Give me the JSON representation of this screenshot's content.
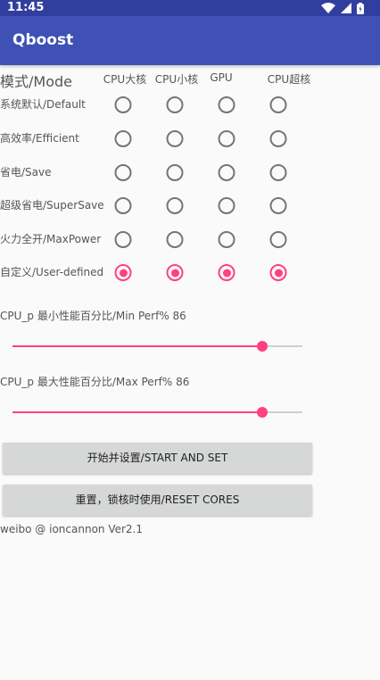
{
  "status_bar": {
    "time": "11:45"
  },
  "app": {
    "title": "Qboost"
  },
  "table": {
    "mode_header": "模式/Mode",
    "columns": [
      "CPU大核",
      "CPU小核",
      "GPU",
      "CPU超核"
    ],
    "rows": [
      {
        "label": "系统默认/Default",
        "checked": [
          false,
          false,
          false,
          false
        ]
      },
      {
        "label": "高效率/Efficient",
        "checked": [
          false,
          false,
          false,
          false
        ]
      },
      {
        "label": "省电/Save",
        "checked": [
          false,
          false,
          false,
          false
        ]
      },
      {
        "label": "超级省电/SuperSave",
        "checked": [
          false,
          false,
          false,
          false
        ]
      },
      {
        "label": "火力全开/MaxPower",
        "checked": [
          false,
          false,
          false,
          false
        ]
      },
      {
        "label": "自定义/User-defined",
        "checked": [
          true,
          true,
          true,
          true
        ]
      }
    ]
  },
  "sliders": {
    "min": {
      "label": "CPU_p 最小性能百分比/Min Perf% 86",
      "value_percent": 86
    },
    "max": {
      "label": "CPU_p 最大性能百分比/Max Perf% 86",
      "value_percent": 86
    }
  },
  "buttons": {
    "start": "开始并设置/START AND SET",
    "reset": "重置，锁核时使用/RESET CORES"
  },
  "footer": "weibo @ ioncannon Ver2.1",
  "colors": {
    "primary": "#3f51b5",
    "primary_dark": "#303f9f",
    "accent": "#ff4081"
  }
}
